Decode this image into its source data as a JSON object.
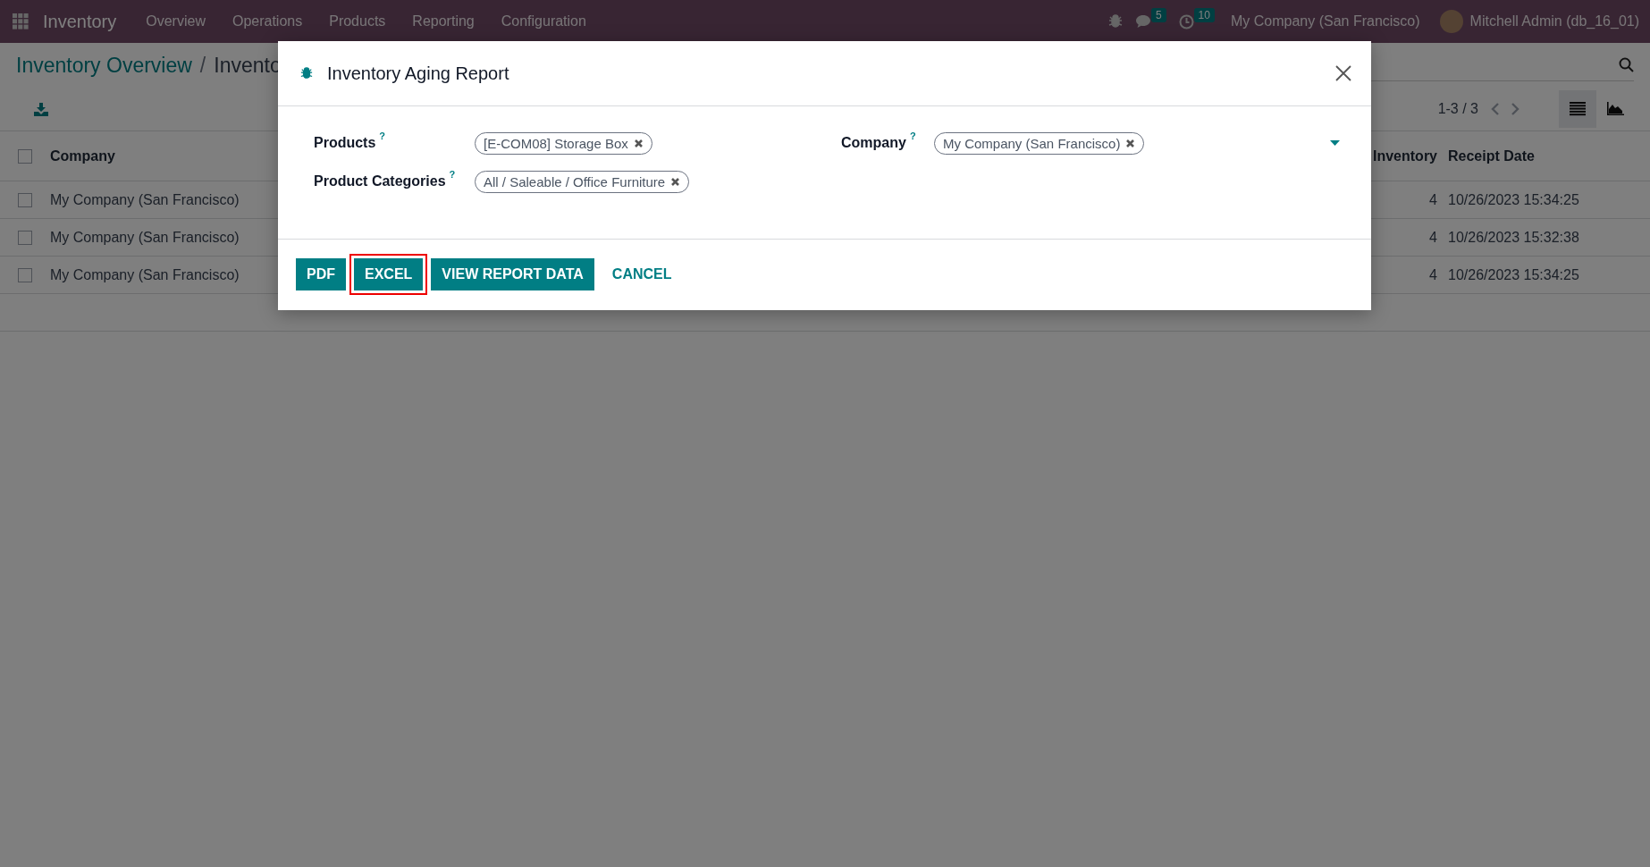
{
  "navbar": {
    "app_name": "Inventory",
    "menu": [
      "Overview",
      "Operations",
      "Products",
      "Reporting",
      "Configuration"
    ],
    "systray": {
      "chat_count": "5",
      "activity_count": "10",
      "company": "My Company (San Francisco)",
      "user": "Mitchell Admin (db_16_01)"
    }
  },
  "breadcrumb": {
    "items": [
      "Inventory Overview",
      "Invento"
    ],
    "separator": "/"
  },
  "control_panel": {
    "pager": "1-3 / 3",
    "views": [
      {
        "kind": "list",
        "selected": true
      },
      {
        "kind": "graph",
        "selected": false
      }
    ]
  },
  "table": {
    "select_all": {
      "checked": false
    },
    "columns": [
      "Company",
      "Inventory",
      "Receipt Date"
    ],
    "rows": [
      {
        "checked": false,
        "company": "My Company (San Francisco)",
        "quantity": "4",
        "receipt_date": "10/26/2023 15:34:25"
      },
      {
        "checked": false,
        "company": "My Company (San Francisco)",
        "quantity": "4",
        "receipt_date": "10/26/2023 15:32:38"
      },
      {
        "checked": false,
        "company": "My Company (San Francisco)",
        "quantity": "4",
        "receipt_date": "10/26/2023 15:34:25"
      }
    ]
  },
  "dialog": {
    "title": "Inventory Aging Report",
    "fields_left": [
      {
        "label": "Products",
        "help": "?",
        "tags": [
          "[E-COM08] Storage Box"
        ],
        "dropdown": false
      },
      {
        "label": "Product Categories",
        "help": "?",
        "tags": [
          "All / Saleable / Office Furniture"
        ],
        "dropdown": false
      }
    ],
    "fields_right": [
      {
        "label": "Company",
        "help": "?",
        "tags": [
          "My Company (San Francisco)"
        ],
        "dropdown": true
      }
    ],
    "buttons": [
      {
        "label": "PDF",
        "kind": "primary",
        "highlighted": false
      },
      {
        "label": "EXCEL",
        "kind": "primary",
        "highlighted": true
      },
      {
        "label": "VIEW REPORT DATA",
        "kind": "primary",
        "highlighted": false
      },
      {
        "label": "CANCEL",
        "kind": "link",
        "highlighted": false
      }
    ]
  }
}
